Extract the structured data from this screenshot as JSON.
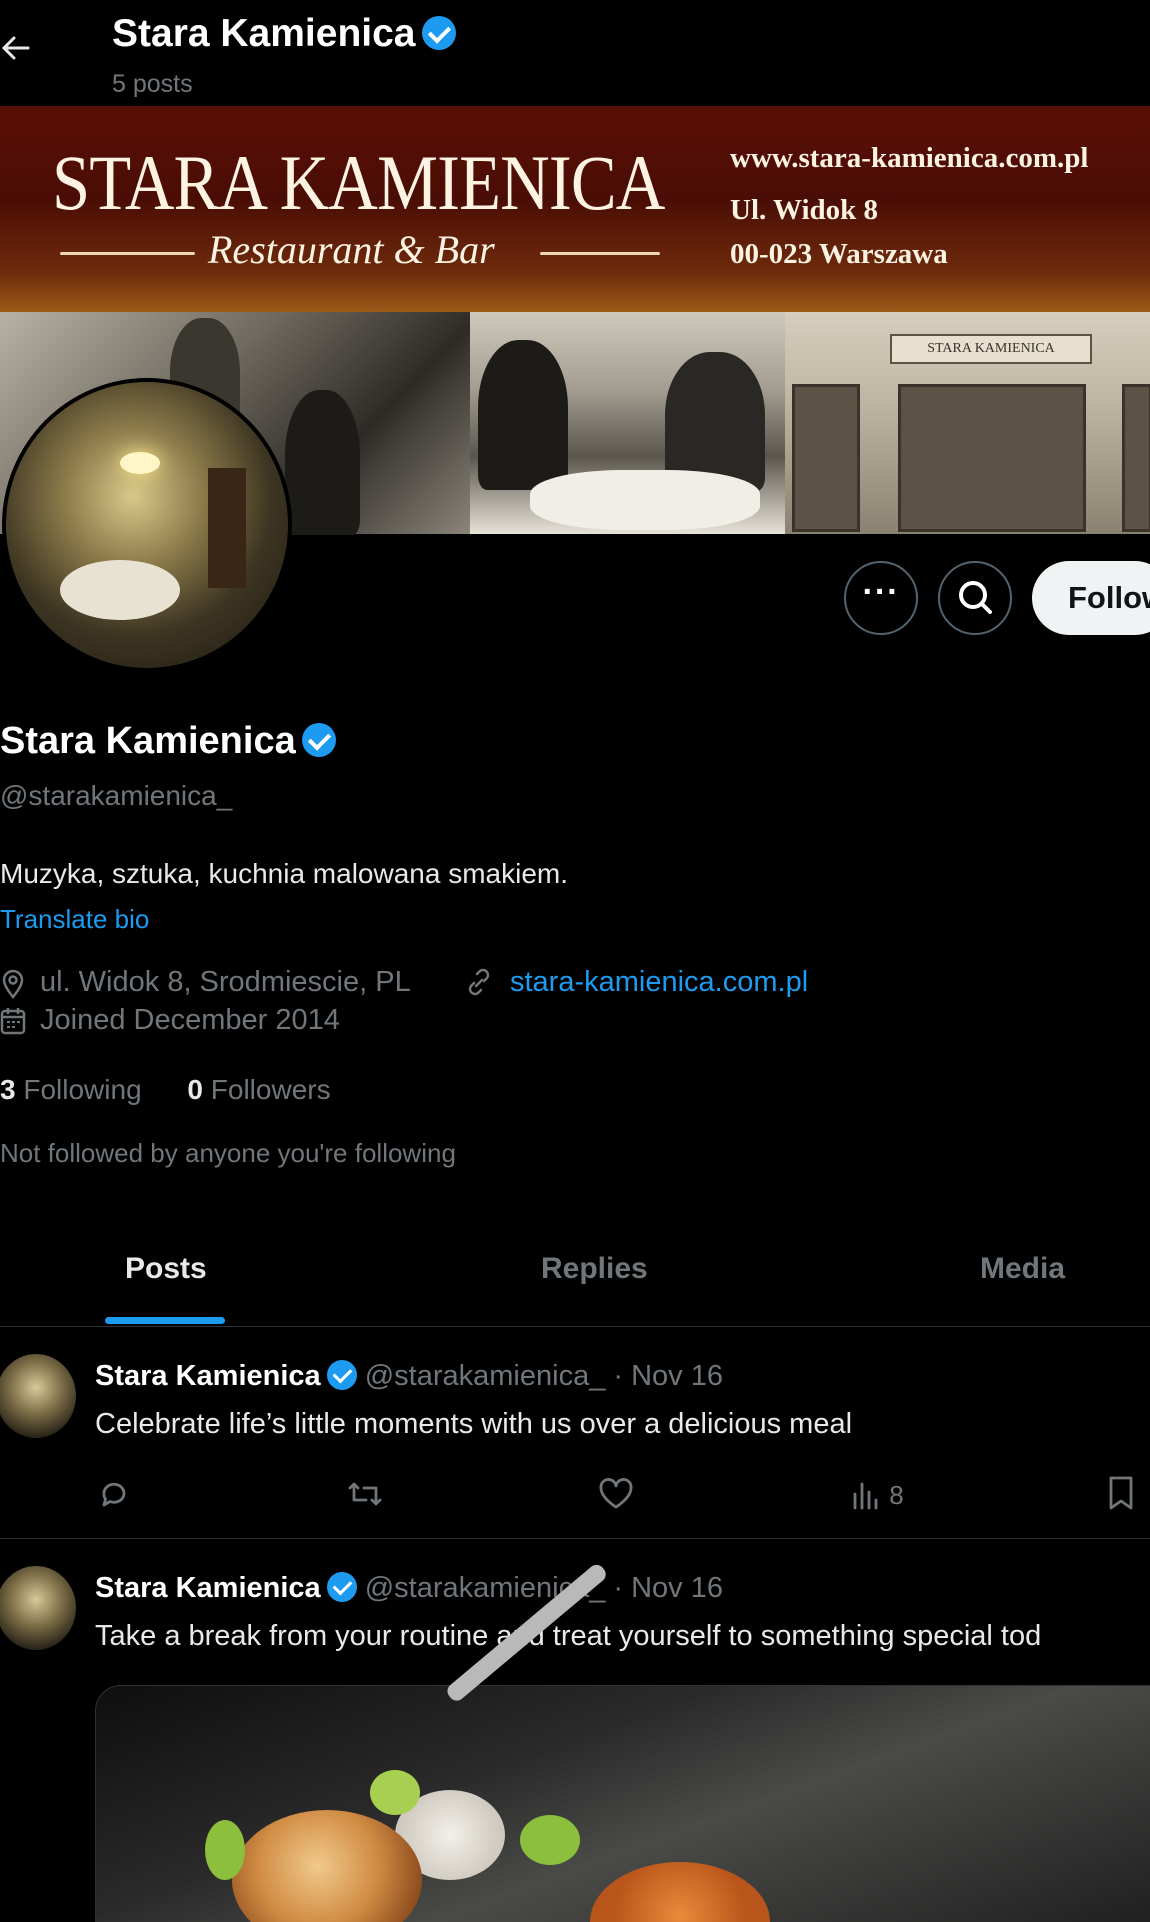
{
  "header": {
    "back_icon": "arrow-left-icon",
    "title": "Stara Kamienica",
    "post_count": "5 posts"
  },
  "banner": {
    "title": "STARA KAMIENICA",
    "subtitle": "Restaurant & Bar",
    "url": "www.stara-kamienica.com.pl",
    "street": "Ul. Widok 8",
    "city": "00-023 Warszawa",
    "storefront_sign": "STARA KAMIENICA"
  },
  "actions": {
    "more_label": "···",
    "search_icon": "search-icon",
    "follow_label": "Follow"
  },
  "profile": {
    "name": "Stara Kamienica",
    "handle": "@starakamienica_",
    "bio": "Muzyka, sztuka, kuchnia malowana smakiem.",
    "translate_label": "Translate bio",
    "location": "ul. Widok 8, Srodmiescie, PL",
    "website": "stara-kamienica.com.pl",
    "joined": "Joined December 2014",
    "following_count": "3",
    "following_label": "Following",
    "followers_count": "0",
    "followers_label": "Followers",
    "not_followed": "Not followed by anyone you're following"
  },
  "tabs": [
    {
      "label": "Posts",
      "active": true
    },
    {
      "label": "Replies",
      "active": false
    },
    {
      "label": "Media",
      "active": false
    }
  ],
  "posts": [
    {
      "name": "Stara Kamienica",
      "handle_date": "@starakamienica_ · Nov 16",
      "text": "Celebrate life’s little moments with us over a delicious meal",
      "views": "8"
    },
    {
      "name": "Stara Kamienica",
      "handle_date": "@starakamienica_ · Nov 16",
      "text": "Take a break from your routine and treat yourself to something special tod"
    }
  ],
  "colors": {
    "accent": "#1d9bf0",
    "background": "#000000",
    "secondary_text": "#71767b"
  }
}
